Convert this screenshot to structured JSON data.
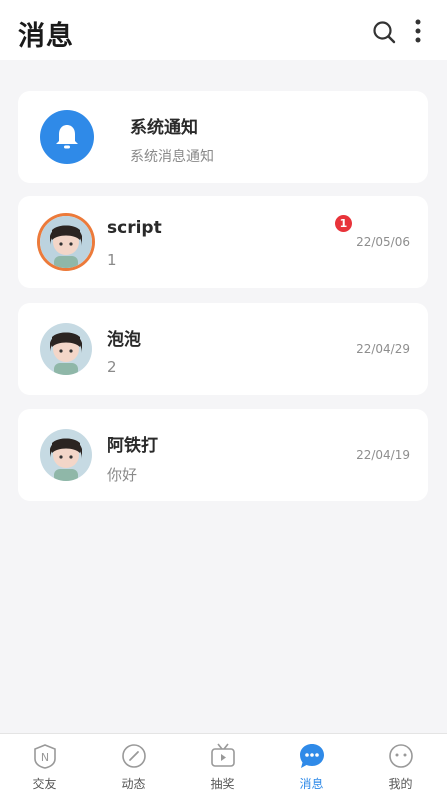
{
  "header": {
    "title": "消息",
    "search_icon": "search-icon",
    "more_icon": "more-vertical-icon"
  },
  "system_notice": {
    "icon": "bell-icon",
    "title": "系统通知",
    "subtitle": "系统消息通知"
  },
  "conversations": [
    {
      "name": "script",
      "preview": "1",
      "date": "22/05/06",
      "unread": "1",
      "avatar_ring": true
    },
    {
      "name": "泡泡",
      "preview": "2",
      "date": "22/04/29",
      "unread": "",
      "avatar_ring": false
    },
    {
      "name": "阿铁打",
      "preview": "你好",
      "date": "22/04/19",
      "unread": "",
      "avatar_ring": false
    }
  ],
  "tabbar": {
    "active_color": "#2f8ae8",
    "items": [
      {
        "label": "交友",
        "icon": "n-badge-icon"
      },
      {
        "label": "动态",
        "icon": "compass-icon"
      },
      {
        "label": "抽奖",
        "icon": "tv-icon"
      },
      {
        "label": "消息",
        "icon": "chat-bubble-icon",
        "active": true
      },
      {
        "label": "我的",
        "icon": "face-icon"
      }
    ]
  }
}
